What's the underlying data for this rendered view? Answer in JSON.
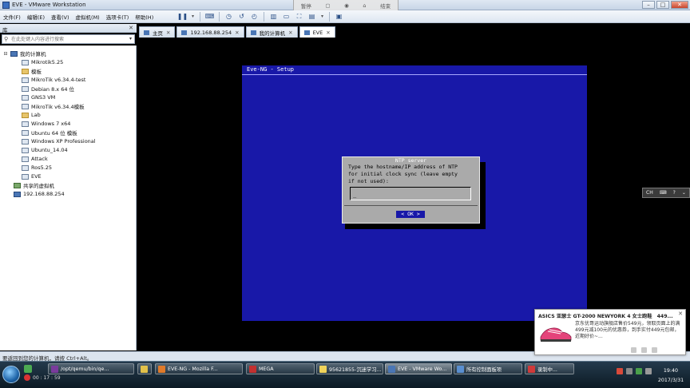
{
  "window": {
    "title": "EVE - VMware Workstation",
    "controls": [
      "–",
      "□",
      "✕"
    ]
  },
  "snip_toolbar": [
    "暂停",
    "",
    "",
    "",
    "结束"
  ],
  "menu": [
    "文件(F)",
    "编辑(E)",
    "查看(V)",
    "虚拟机(M)",
    "选项卡(T)",
    "帮助(H)"
  ],
  "toolbar": {
    "icons": [
      "pause-icon",
      "send-keys-icon",
      "snapshot-icon",
      "revert-snapshot-icon",
      "snapshot-manager-icon",
      "sidebar-toggle-icon",
      "thumbnail-icon",
      "fullscreen-icon",
      "unity-icon",
      "console-view-icon"
    ]
  },
  "library": {
    "header": "库",
    "close": "✕",
    "search_placeholder": "在此处键入内容进行搜索",
    "root": "我的计算机",
    "items": [
      {
        "label": "Mikrotik5.25",
        "icon": "vm"
      },
      {
        "label": "模板",
        "icon": "folder"
      },
      {
        "label": "MikroTik v6.34.4-test",
        "icon": "vm"
      },
      {
        "label": "Debian 8.x 64 位",
        "icon": "vm"
      },
      {
        "label": "GNS3 VM",
        "icon": "vm"
      },
      {
        "label": "MikroTik v6.34.4模板",
        "icon": "vm"
      },
      {
        "label": "Lab",
        "icon": "folder"
      },
      {
        "label": "Windows 7 x64",
        "icon": "vm"
      },
      {
        "label": "Ubuntu 64 位 模板",
        "icon": "vm"
      },
      {
        "label": "Windows XP Professional",
        "icon": "vm"
      },
      {
        "label": "Ubuntu_14.04",
        "icon": "vm"
      },
      {
        "label": "Attack",
        "icon": "vm"
      },
      {
        "label": "Ros5.25",
        "icon": "vm"
      },
      {
        "label": "EVE",
        "icon": "vm"
      }
    ],
    "shared": "共享的虚拟机",
    "remote": "192.168.88.254"
  },
  "tabs": [
    {
      "label": "主页",
      "active": false
    },
    {
      "label": "192.168.88.254",
      "active": false
    },
    {
      "label": "我的计算机",
      "active": false
    },
    {
      "label": "EVE",
      "active": true
    }
  ],
  "console": {
    "setup_title": "Eve-NG - Setup",
    "dialog_title": "NTP server",
    "dialog_text": "Type the hostname/IP address of NTP\nfor initial clock sync (leave empty\nif not used):",
    "input_value": "_",
    "ok_label": "< OK >"
  },
  "statusbar": "要返回到您的计算机，请按 Ctrl+Alt。",
  "ime_widget": [
    "CH",
    "?",
    "⌄"
  ],
  "ad": {
    "title": "ASICS 亚瑟士 GT-2000 NEWYORK 4 女士跑鞋　449...",
    "text": "京东优哥运动旗舰店售价549元，领取页面上的满499元减100元的优惠券，到手实付449元包邮，近期好价~...",
    "close": "✕"
  },
  "taskbar": {
    "record_time": "00 : 17 : 59",
    "items": [
      {
        "label": "/opt/qemu/bin/qe...",
        "color": "#7a3b9c"
      },
      {
        "label": "",
        "color": "#e2c14a"
      },
      {
        "label": "EVE-NG - Mozilla F...",
        "color": "#e07a2a"
      },
      {
        "label": "MEGA",
        "color": "#c23030"
      },
      {
        "label": "95621855-沉迷学习...",
        "color": "#f0d35a"
      },
      {
        "label": "EVE - VMware Wo...",
        "color": "#4a76b5"
      },
      {
        "label": "所有控制面板项",
        "color": "#5a8fd0"
      },
      {
        "label": "录制中...",
        "color": "#d03a3a"
      }
    ],
    "clock_time": "19:40",
    "clock_date": "2017/3/31"
  }
}
